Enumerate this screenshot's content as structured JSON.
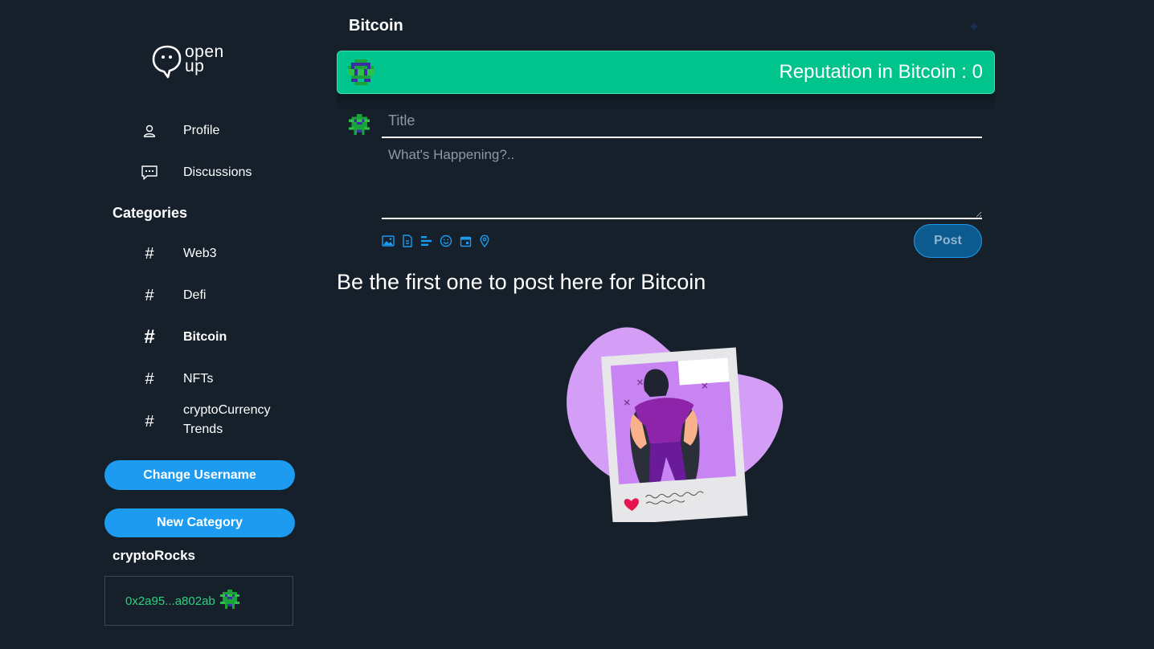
{
  "app": {
    "logo_text_top": "open",
    "logo_text_bottom": "up"
  },
  "sidebar": {
    "nav": [
      {
        "label": "Profile",
        "icon": "person-icon"
      },
      {
        "label": "Discussions",
        "icon": "chat-icon"
      }
    ],
    "categories_title": "Categories",
    "categories": [
      {
        "label": "Web3",
        "active": false
      },
      {
        "label": "Defi",
        "active": false
      },
      {
        "label": "Bitcoin",
        "active": true
      },
      {
        "label": "NFTs",
        "active": false
      },
      {
        "label": "cryptoCurrency Trends",
        "active": false
      }
    ],
    "change_username_label": "Change Username",
    "new_category_label": "New Category",
    "username": "cryptoRocks",
    "wallet_address": "0x2a95...a802ab"
  },
  "main": {
    "page_title": "Bitcoin",
    "reputation_text": "Reputation in Bitcoin : 0",
    "composer": {
      "title_placeholder": "Title",
      "body_placeholder": "What's Happening?..",
      "tools": [
        "image-icon",
        "gif-icon",
        "poll-icon",
        "emoji-icon",
        "schedule-icon",
        "location-icon"
      ],
      "post_label": "Post"
    },
    "empty_message": "Be the first one to post here for Bitcoin"
  },
  "colors": {
    "background": "#15202b",
    "accent": "#1d9bf0",
    "reputation_bg": "#00c48c",
    "wallet_text": "#2ed07e"
  }
}
